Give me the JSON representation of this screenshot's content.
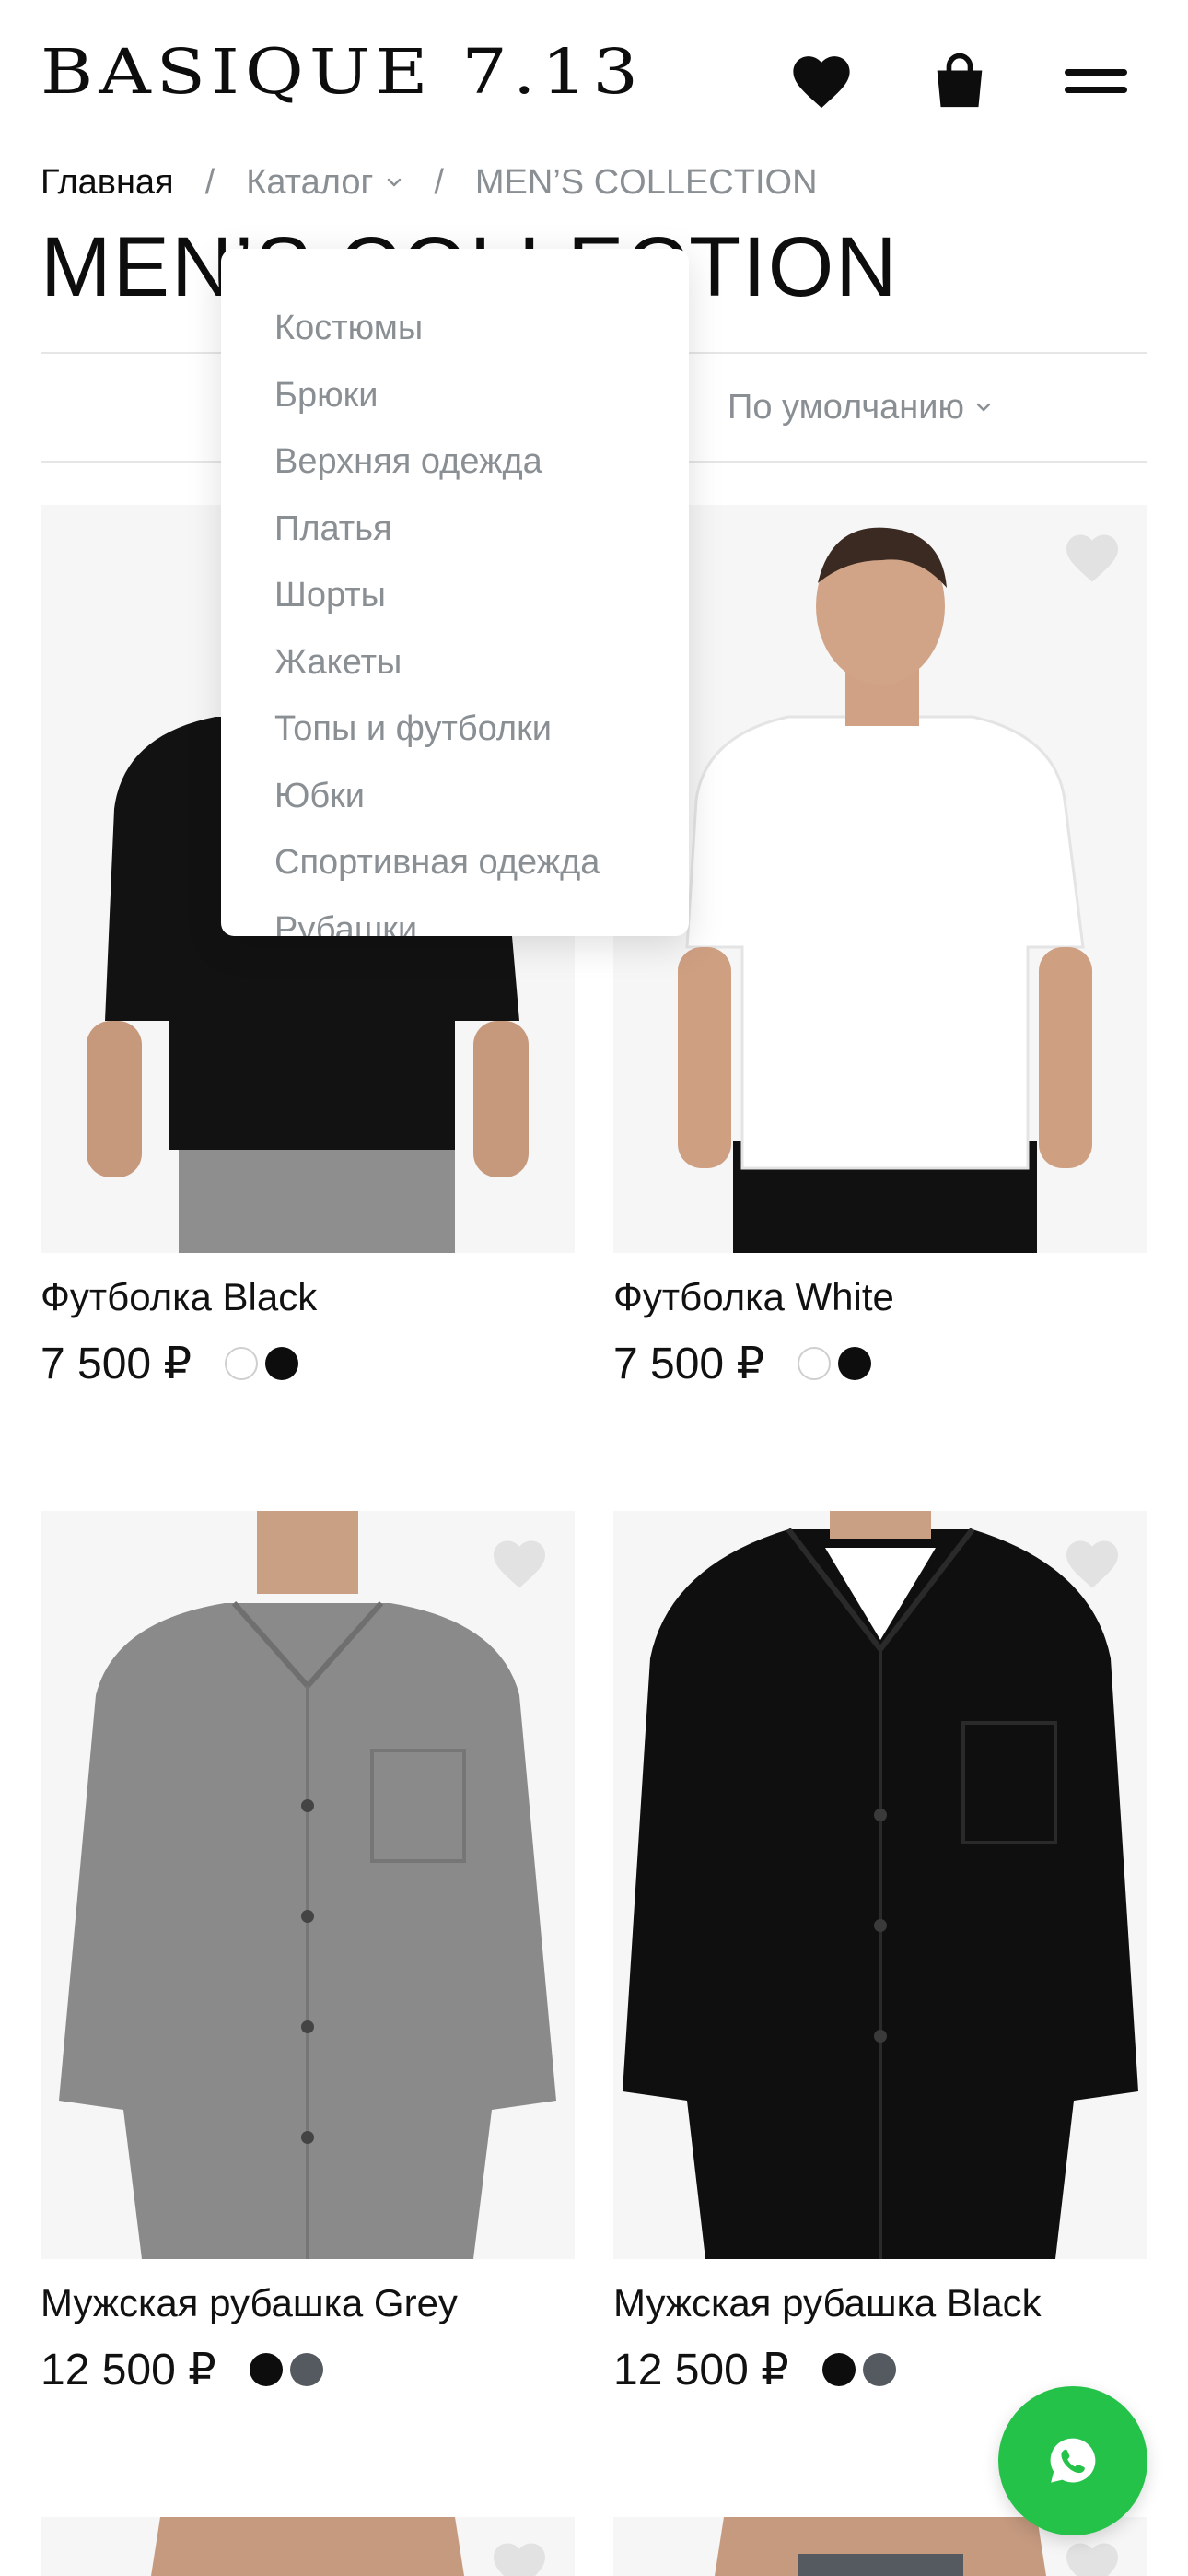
{
  "header": {
    "logo": "BASIQUE 7.13",
    "icons": [
      "heart-icon",
      "shopping-bag-icon",
      "hamburger-menu-icon"
    ]
  },
  "breadcrumb": {
    "home": "Главная",
    "separator": "/",
    "catalog": "Каталог",
    "current": "MEN’S COLLECTION"
  },
  "page": {
    "title": "MEN’S COLLECTION"
  },
  "sort": {
    "label": "По умолчанию"
  },
  "catalog_menu": {
    "items": [
      "Костюмы",
      "Брюки",
      "Верхняя одежда",
      "Платья",
      "Шорты",
      "Жакеты",
      "Топы и футболки",
      "Юбки",
      "Спортивная одежда",
      "Рубашки"
    ]
  },
  "products": [
    {
      "name": "Футболка Black",
      "price": "7 500 ₽",
      "swatches": [
        "white",
        "black"
      ]
    },
    {
      "name": "Футболка White",
      "price": "7 500 ₽",
      "swatches": [
        "white",
        "black"
      ]
    },
    {
      "name": "Мужская рубашка Grey",
      "price": "12 500 ₽",
      "swatches": [
        "black",
        "grey"
      ]
    },
    {
      "name": "Мужская рубашка Black",
      "price": "12 500 ₽",
      "swatches": [
        "black",
        "grey"
      ]
    }
  ],
  "colors": {
    "text": "#0d0d0d",
    "muted": "#8a8f94",
    "whatsapp": "#25c24a",
    "favorite_inactive": "#e2e2e2"
  },
  "floating": {
    "icon": "whatsapp-icon"
  }
}
